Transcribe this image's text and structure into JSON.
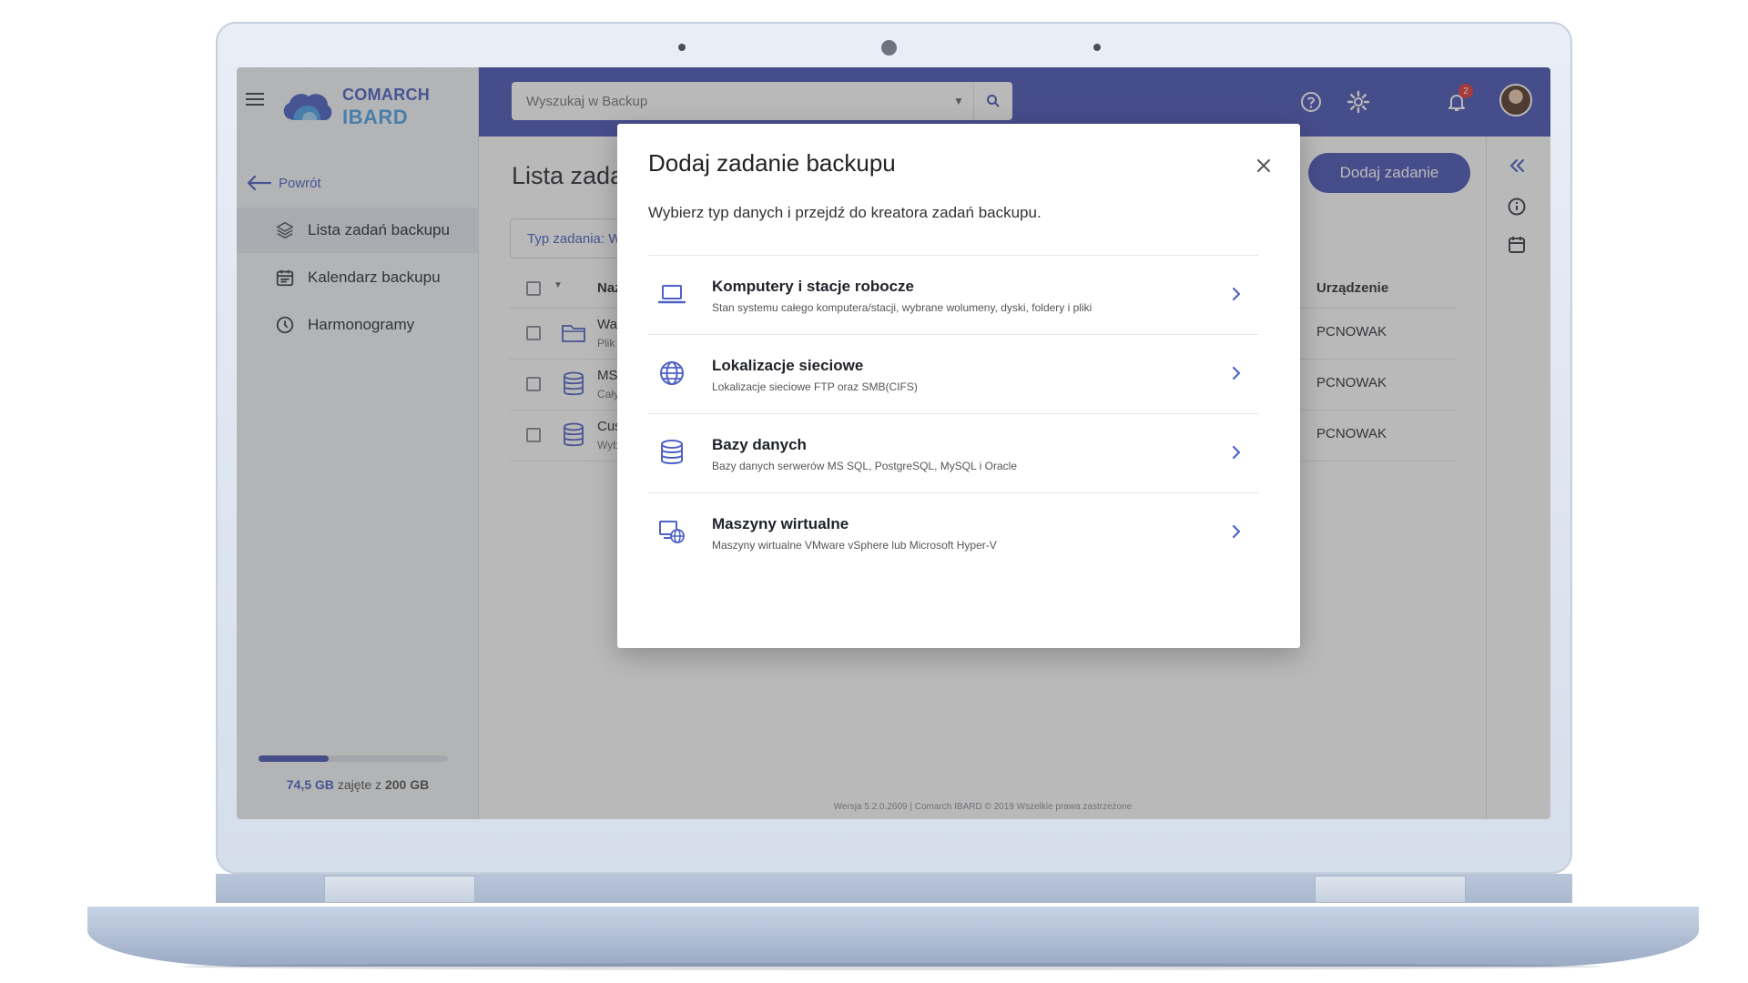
{
  "app": {
    "brand_line1": "COMARCH",
    "brand_line2": "IBARD",
    "accent_color": "#4b56b7"
  },
  "sidebar": {
    "back_label": "Powrót",
    "items": [
      {
        "label": "Lista zadań backupu",
        "icon": "layers-icon",
        "active": true
      },
      {
        "label": "Kalendarz backupu",
        "icon": "calendar-icon",
        "active": false
      },
      {
        "label": "Harmonogramy",
        "icon": "clock-icon",
        "active": false
      }
    ],
    "storage": {
      "used": "74,5 GB",
      "middle": "zajęte z",
      "total": "200 GB",
      "used_fraction": 0.37
    }
  },
  "topbar": {
    "search_placeholder": "Wyszukaj w Backup",
    "notifications_count": "2"
  },
  "main": {
    "title": "Lista zadań",
    "add_button": "Dodaj zadanie",
    "filter_label": "Typ zadania: W",
    "columns": {
      "name": "Naz",
      "device": "Urządzenie"
    },
    "rows": [
      {
        "name": "Wa",
        "sub": "Plik",
        "device": "PCNOWAK",
        "icon": "folder-icon"
      },
      {
        "name": "MS",
        "sub": "Cały",
        "device": "PCNOWAK",
        "icon": "database-icon"
      },
      {
        "name": "Cus",
        "sub": "Wyb",
        "device": "PCNOWAK",
        "icon": "database-icon"
      }
    ],
    "footer": "Wersja  5.2.0.2609  |   Comarch IBARD  © 2019 Wszelkie prawa zastrzeżone"
  },
  "modal": {
    "title": "Dodaj zadanie backupu",
    "description": "Wybierz typ danych i przejdź do kreatora zadań backupu.",
    "options": [
      {
        "title": "Komputery i stacje robocze",
        "desc": "Stan systemu całego komputera/stacji, wybrane wolumeny, dyski, foldery i pliki",
        "icon": "laptop-icon"
      },
      {
        "title": "Lokalizacje sieciowe",
        "desc": "Lokalizacje sieciowe FTP oraz SMB(CIFS)",
        "icon": "globe-icon"
      },
      {
        "title": "Bazy danych",
        "desc": "Bazy danych serwerów MS SQL, PostgreSQL, MySQL i Oracle",
        "icon": "database-icon"
      },
      {
        "title": "Maszyny wirtualne",
        "desc": "Maszyny wirtualne VMware vSphere lub Microsoft Hyper-V",
        "icon": "virtual-machine-icon"
      }
    ]
  }
}
